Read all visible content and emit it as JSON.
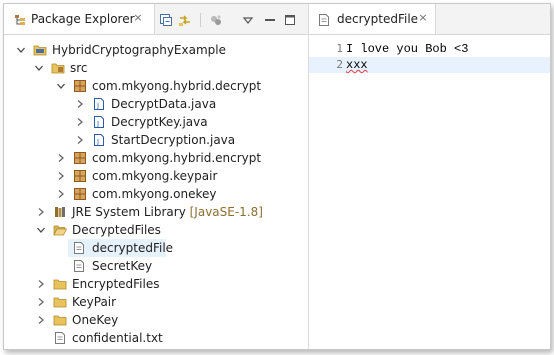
{
  "explorer": {
    "tab_label": "Package Explorer",
    "tab_icon": "package-explorer-icon",
    "close_symbol": "×",
    "toolbar": [
      "collapse-all-icon",
      "link-with-editor-icon",
      "filters-icon",
      "view-menu-icon",
      "minimize-icon",
      "maximize-icon"
    ]
  },
  "tree": {
    "project": "HybridCryptographyExample",
    "src": "src",
    "pkg_decrypt": "com.mkyong.hybrid.decrypt",
    "file_decryptdata": "DecryptData.java",
    "file_decryptkey": "DecryptKey.java",
    "file_startdecryption": "StartDecryption.java",
    "pkg_encrypt": "com.mkyong.hybrid.encrypt",
    "pkg_keypair": "com.mkyong.keypair",
    "pkg_onekey": "com.mkyong.onekey",
    "jre": "JRE System Library",
    "jre_decoration": "[JavaSE-1.8]",
    "folder_decrypted": "DecryptedFiles",
    "file_decryptedfile": "decryptedFile",
    "file_secretkey": "SecretKey",
    "folder_encrypted": "EncryptedFiles",
    "folder_keypair": "KeyPair",
    "folder_onekey": "OneKey",
    "file_confidential": "confidential.txt"
  },
  "editor": {
    "tab_label": "decryptedFile",
    "close_symbol": "×",
    "line1_num": "1",
    "line1_text": "I love you Bob <3",
    "line2_num": "2",
    "line2_text": "xxx"
  },
  "colors": {
    "selection": "#e5f1fb",
    "current_line": "#e8f2fe",
    "folder": "#e8c25a",
    "package": "#b07a3a",
    "java_file": "#2a5aa8",
    "decoration": "#8c6f32"
  }
}
